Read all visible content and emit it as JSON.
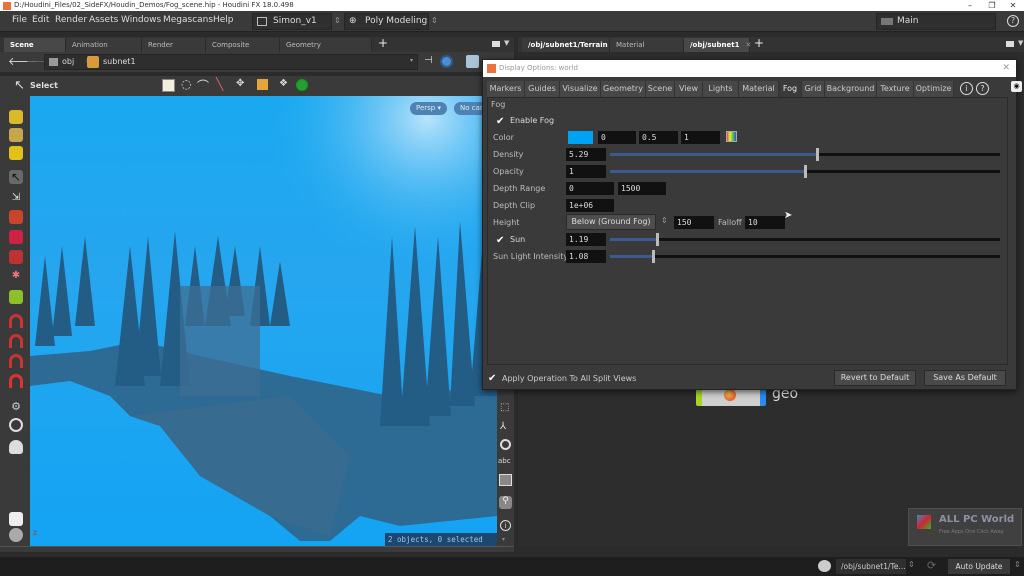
{
  "window": {
    "title": "D:/Houdini_Files/02_SideFX/Houdin_Demos/Fog_scene.hip - Houdini FX 18.0.498",
    "minimize": "–",
    "maximize": "❐",
    "close": "✕"
  },
  "menubar": {
    "items": [
      "File",
      "Edit",
      "Render",
      "Assets",
      "Windows",
      "Megascans",
      "Help"
    ],
    "desktop": "Simon_v1",
    "shelf_set": "Poly Modeling",
    "main_desktop": "Main",
    "help": "?"
  },
  "left_tabs": [
    {
      "label": "Scene View",
      "active": true
    },
    {
      "label": "Animation Editor",
      "active": false
    },
    {
      "label": "Render View",
      "active": false
    },
    {
      "label": "Composite View",
      "active": false
    },
    {
      "label": "Geometry Spreadsheet",
      "active": false
    }
  ],
  "right_tabs": [
    {
      "label": "/obj/subnet1/Terrain",
      "active": false
    },
    {
      "label": "Material Palette",
      "active": false
    },
    {
      "label": "/obj/subnet1",
      "active": true
    }
  ],
  "path": {
    "root": "obj",
    "node": "subnet1"
  },
  "viewer": {
    "tool": "Select",
    "camera": "Persp ▾",
    "cam_menu": "No cam",
    "status": "2 objects, 0 selected",
    "text_icon": "abc"
  },
  "dialog": {
    "title": "Display Options: world",
    "tabs": [
      "Markers",
      "Guides",
      "Visualize",
      "Geometry",
      "Scene",
      "View",
      "Lights",
      "Material",
      "Fog",
      "Grid",
      "Background",
      "Texture",
      "Optimize"
    ],
    "active_tab": "Fog",
    "section": "Fog",
    "enable_fog": {
      "label": "Enable Fog",
      "checked": true
    },
    "color": {
      "label": "Color",
      "swatch": "#00a2f2",
      "r": "0",
      "g": "0.5",
      "b": "1"
    },
    "density": {
      "label": "Density",
      "value": "5.29",
      "slider_fraction": 0.53
    },
    "opacity": {
      "label": "Opacity",
      "value": "1",
      "slider_fraction": 0.5
    },
    "depth_range": {
      "label": "Depth Range",
      "min": "0",
      "max": "1500"
    },
    "depth_clip": {
      "label": "Depth Clip",
      "value": "1e+06"
    },
    "height": {
      "label": "Height",
      "mode": "Below (Ground Fog)",
      "value": "150",
      "falloff_label": "Falloff",
      "falloff": "10"
    },
    "sun": {
      "label": "Sun",
      "checked": true,
      "value": "1.19",
      "slider_fraction": 0.12
    },
    "sun_intensity": {
      "label": "Sun Light Intensity",
      "value": "1.08",
      "slider_fraction": 0.11
    },
    "apply_all": {
      "label": "Apply Operation To All Split Views",
      "checked": true
    },
    "revert_button": "Revert to Default",
    "save_button": "Save As Default"
  },
  "network": {
    "node_label": "geo"
  },
  "statusbar": {
    "path": "/obj/subnet1/Te...",
    "update_mode": "Auto Update"
  },
  "watermark": {
    "title": "ALL PC World",
    "subtitle": "Free Apps One Click Away"
  }
}
